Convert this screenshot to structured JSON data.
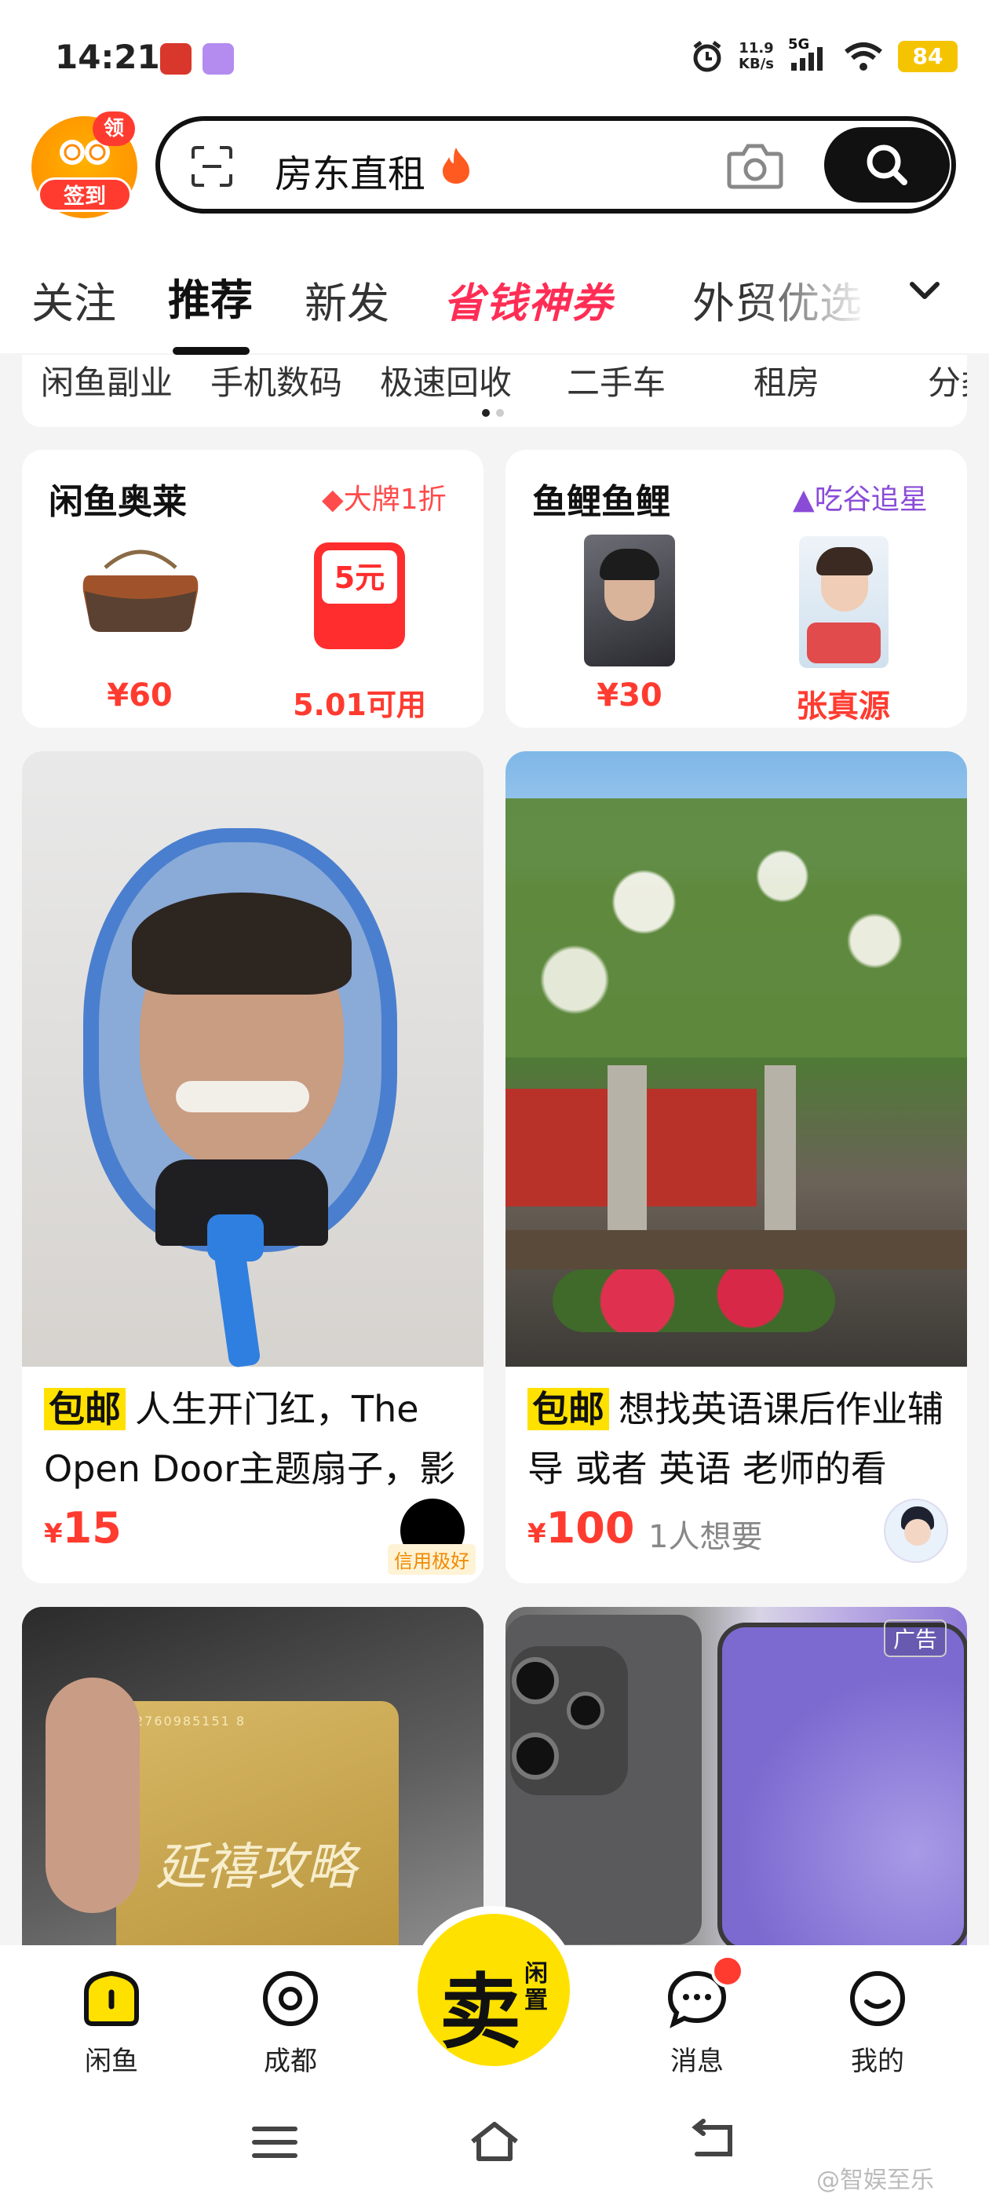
{
  "status_bar": {
    "time": "14:21",
    "net_speed_value": "11.9",
    "net_speed_unit": "KB/s",
    "network": "5G",
    "battery": "84"
  },
  "header": {
    "signin_badge": "领",
    "signin_label": "签到",
    "search_text": "房东直租"
  },
  "tabs": [
    {
      "label": "关注",
      "active": false
    },
    {
      "label": "推荐",
      "active": true
    },
    {
      "label": "新发",
      "active": false
    },
    {
      "label": "省钱神券",
      "active": false
    },
    {
      "label": "外贸优选",
      "active": false
    }
  ],
  "categories": [
    "闲鱼副业",
    "手机数码",
    "极速回收",
    "二手车",
    "租房",
    "分类"
  ],
  "promo_cards": [
    {
      "title": "闲鱼奥莱",
      "tag": "大牌1折",
      "tag_color": "#ff4b4b",
      "items": [
        {
          "price": "¥60",
          "image": "bag"
        },
        {
          "label": "5.01可用",
          "image": "red-packet",
          "coupon": "5元"
        }
      ]
    },
    {
      "title": "鱼鲤鱼鲤",
      "tag": "吃谷追星",
      "tag_color": "#8a4bd8",
      "items": [
        {
          "price": "¥30",
          "image": "photocard"
        },
        {
          "label": "张真源",
          "image": "photocard-2"
        }
      ]
    }
  ],
  "feed": [
    {
      "tag": "包邮",
      "title": "人生开门红，The Open Door主题扇子，影",
      "currency": "¥",
      "price": "15",
      "seller_badge": "信用极好"
    },
    {
      "tag": "包邮",
      "title": "想找英语课后作业辅导 或者 英语 老师的看",
      "currency": "¥",
      "price": "100",
      "want": "1人想要"
    },
    {
      "card_text": "2760985151 8",
      "card_art": "延禧攻略"
    },
    {
      "ad_label": "广告"
    }
  ],
  "bottom_nav": {
    "items": [
      {
        "label": "闲鱼",
        "icon": "home-icon"
      },
      {
        "label": "成都",
        "icon": "location-icon"
      },
      {
        "label": "消息",
        "icon": "message-icon"
      },
      {
        "label": "我的",
        "icon": "profile-icon"
      }
    ],
    "sell_main": "卖",
    "sell_sub": "闲置"
  },
  "watermark": "@智娱至乐",
  "colors": {
    "brand_yellow": "#ffe100",
    "price_red": "#ff3b30"
  }
}
